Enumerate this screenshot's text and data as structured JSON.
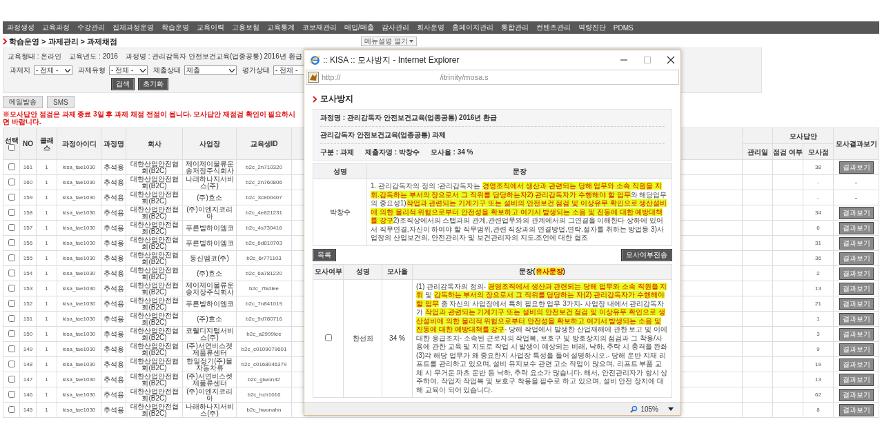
{
  "nav": [
    "과정생성",
    "교육과정",
    "수강관리",
    "집체과정운영",
    "학습운영",
    "교육이력",
    "고용보험",
    "교육통계",
    "코보재관리",
    "매입/매출",
    "감사관리",
    "회사운영",
    "홈페이지관리",
    "통합관리",
    "컨텐츠관리",
    "역량진단",
    "PDMS"
  ],
  "breadcrumb": "학습운영 > 과제관리 > 과제채점",
  "menu_help_button": "메뉴설명 열기",
  "filters": {
    "info": [
      "교육형태 : 온라인",
      "교육년도 : 2016",
      "과정명 : 관리감독자 안전보건교육(업종공통) 2016년 환급"
    ],
    "selects": [
      {
        "label": "과제지",
        "value": "- 전체 -"
      },
      {
        "label": "과제유형",
        "value": "- 전체 -"
      },
      {
        "label": "제출상태",
        "value": "제출"
      },
      {
        "label": "평가상태",
        "value": "- 전체 -"
      }
    ],
    "buttons": [
      "검색",
      "초기화"
    ]
  },
  "actions": [
    "메일발송",
    "SMS"
  ],
  "notice": "※모사답안 점검은 과제 종료 3일 후 과제 채점 전점이 됩니다. 모사답안 재점검 확인이 필요하시면 바랍니다.",
  "table": {
    "select_header": "선택",
    "select_all_checked": false,
    "columns_left": [
      "NO",
      "클래스",
      "과정아이디",
      "과정명",
      "회사",
      "사업장",
      "교육생ID"
    ],
    "columns_right": {
      "group": "모사답안",
      "date": "관리일",
      "check": "점검 여부",
      "score": "모사점",
      "result": "모사결과보기"
    },
    "rows": [
      {
        "checked": false,
        "no": "161",
        "class": "1",
        "course_id": "kisa_tae1030",
        "course_name": "추석용",
        "company": "대한산업안전협회(B2C)",
        "site": "제이제이물류운송저장주식회사",
        "student_id": "b2c_2n710320",
        "score": "38",
        "result": {
          "kind": "button",
          "label": "결과보기"
        }
      },
      {
        "checked": false,
        "no": "160",
        "class": "1",
        "course_id": "kisa_tae1030",
        "course_name": "추석용",
        "company": "대한산업안전협회(B2C)",
        "site": "나래하나지서비스(주)",
        "student_id": "b2c_2n760806",
        "score": "-",
        "result": {
          "kind": "text",
          "label": "-"
        }
      },
      {
        "checked": false,
        "no": "159",
        "class": "1",
        "course_id": "kisa_tae1030",
        "course_name": "추석용",
        "company": "대한산업안전협회(B2C)",
        "site": "(주)효소",
        "student_id": "b2c_3c800407",
        "score": "-",
        "result": {
          "kind": "text",
          "label": "-"
        }
      },
      {
        "checked": false,
        "no": "158",
        "class": "1",
        "course_id": "kisa_tae1030",
        "course_name": "추석용",
        "company": "대한산업안전협회(B2C)",
        "site": "(주)이엔지코리아",
        "student_id": "b2c_4e821231",
        "score": "34",
        "result": {
          "kind": "button",
          "label": "결과보기"
        }
      },
      {
        "checked": false,
        "no": "157",
        "class": "1",
        "course_id": "kisa_tae1030",
        "course_name": "추석용",
        "company": "대한산업안전협회(B2C)",
        "site": "푸른빌하이엠코",
        "student_id": "b2c_4s730416",
        "score": "6",
        "result": {
          "kind": "button",
          "label": "결과보기"
        }
      },
      {
        "checked": false,
        "no": "156",
        "class": "1",
        "course_id": "kisa_tae1030",
        "course_name": "추석용",
        "company": "대한산업안전협회(B2C)",
        "site": "푸른빌하이엠코",
        "student_id": "b2c_6d810703",
        "score": "31",
        "result": {
          "kind": "button",
          "label": "결과보기"
        }
      },
      {
        "checked": false,
        "no": "155",
        "class": "1",
        "course_id": "kisa_tae1030",
        "course_name": "추석용",
        "company": "대한산업안전협회(B2C)",
        "site": "동신엠코(주)",
        "student_id": "b2c_6r771103",
        "score": "36",
        "result": {
          "kind": "button",
          "label": "결과보기"
        }
      },
      {
        "checked": false,
        "no": "154",
        "class": "1",
        "course_id": "kisa_tae1030",
        "course_name": "추석용",
        "company": "대한산업안전협회(B2C)",
        "site": "(주)효소",
        "student_id": "b2c_6a781220",
        "score": "2",
        "result": {
          "kind": "button",
          "label": "결과보기"
        }
      },
      {
        "checked": false,
        "no": "153",
        "class": "1",
        "course_id": "kisa_tae1030",
        "course_name": "추석용",
        "company": "대한산업안전협회(B2C)",
        "site": "제이제이물류운송저장주식회사",
        "student_id": "b2c_7tkdlee",
        "score": "13",
        "result": {
          "kind": "button",
          "label": "결과보기"
        }
      },
      {
        "checked": false,
        "no": "152",
        "class": "1",
        "course_id": "kisa_tae1030",
        "course_name": "추석용",
        "company": "대한산업안전협회(B2C)",
        "site": "푸른빌하이엠코",
        "student_id": "b2c_7n841019",
        "score": "21",
        "result": {
          "kind": "button",
          "label": "결과보기"
        }
      },
      {
        "checked": false,
        "no": "151",
        "class": "1",
        "course_id": "kisa_tae1030",
        "course_name": "추석용",
        "company": "대한산업안전협회(B2C)",
        "site": "(주)효소",
        "student_id": "b2c_9d780716",
        "score": "1",
        "result": {
          "kind": "button",
          "label": "결과보기"
        }
      },
      {
        "checked": false,
        "no": "150",
        "class": "1",
        "course_id": "kisa_tae1030",
        "course_name": "추석용",
        "company": "대한산업안전협회(B2C)",
        "site": "코웰디지털서비스(주)",
        "student_id": "b2c_a2999lee",
        "score": "3",
        "result": {
          "kind": "button",
          "label": "결과보기"
        }
      },
      {
        "checked": false,
        "no": "149",
        "class": "1",
        "course_id": "kisa_tae1030",
        "course_name": "추석용",
        "company": "대한산업안전협회(B2C)",
        "site": "(주)서연비스켓제품류센터",
        "student_id": "b2c_c0109079601",
        "score": "9",
        "result": {
          "kind": "button",
          "label": "결과보기"
        }
      },
      {
        "checked": false,
        "no": "148",
        "class": "1",
        "course_id": "kisa_tae1030",
        "course_name": "추석용",
        "company": "대한산업안전협회(B2C)",
        "site": "한일정기(주)물자동차류",
        "student_id": "b2c_c0168046379",
        "score": "19",
        "result": {
          "kind": "button",
          "label": "결과보기"
        }
      },
      {
        "checked": false,
        "no": "147",
        "class": "1",
        "course_id": "kisa_tae1030",
        "course_name": "추석용",
        "company": "대한산업안전협회(B2C)",
        "site": "(주)서연비스켓제품류센터",
        "student_id": "b2c_giwon32",
        "score": "13",
        "result": {
          "kind": "button",
          "label": "결과보기"
        }
      },
      {
        "checked": false,
        "no": "146",
        "class": "1",
        "course_id": "kisa_tae1030",
        "course_name": "추석용",
        "company": "대한산업안전협회(B2C)",
        "site": "(주)이엔지코리아",
        "student_id": "b2c_hch1016",
        "score": "62",
        "result": {
          "kind": "button",
          "label": "결과보기"
        }
      },
      {
        "checked": false,
        "no": "145",
        "class": "1",
        "course_id": "kisa_tae1030",
        "course_name": "추석용",
        "company": "대한산업안전협회(B2C)",
        "site": "나래하나지서비스(주)",
        "student_id": "b2c_hwonahn",
        "score": "8",
        "result": {
          "kind": "button",
          "label": "결과보기"
        }
      }
    ]
  },
  "popup": {
    "title": ":: KISA :: 모사방지 - Internet Explorer",
    "url_start": "http://",
    "url_end": "/itrinity/mosa.s",
    "heading": "모사방지",
    "info": {
      "course": "과정명 : 관리감독자 안전보건교육(업종공통) 2016년 환급",
      "assignment": "관리감독자 안전보건교육(업종공통) 과제",
      "meta": [
        "구분 : 과제",
        "제출자명 : 박창수",
        "모사율 : 34 %"
      ]
    },
    "submission": {
      "columns": [
        "성명",
        "문장"
      ],
      "name": "박창수",
      "sentence": [
        {
          "text": "1. 관리감독자의 정의 :관리감독자는 ",
          "highlighted": false
        },
        {
          "text": "경영조직에서 생산과 관련되는 당해 업무와 소속 직원을 지휘.감독하는 부서의 장으로서 그 직위를 담당하는자2) 관리감독자가 수행해야 할 업무",
          "highlighted": true
        },
        {
          "text": "와 해당업무의 중요성1)",
          "highlighted": false
        },
        {
          "text": "작업과 관련되는 기계기구 또는 설비의 안전보건 점검 및 이상유무 확인으로 생산설비에 의한 물리적 위험으로부터 안전성을 확보하고 여기서 발생되는 소음 및 진동에 대한 예방대책를 강구",
          "highlighted": true
        },
        {
          "text": "2)조직상에서의 스탭과의 관계,관련업무와의 관계에서의 그연결을 이해한다 상하에 있어서 직무연결,자신이 하여야 할 직무범위,관련 직장과의 연결방법,연락.절차를 취하는 방법등 3)사업장의 산업보건의, 안전관리자 및 보건관리자의 지도.조언에 대한 협조",
          "highlighted": false
        }
      ]
    },
    "buttons": [
      "목록",
      "모사여부전송"
    ],
    "matches": {
      "columns": [
        "모사여부",
        "성명",
        "모사율"
      ],
      "header_sentence": [
        {
          "text": "문장(",
          "highlighted": false
        },
        {
          "text": "유사문장",
          "highlighted": true
        },
        {
          "text": ")",
          "highlighted": false
        }
      ],
      "rows": [
        {
          "checked": false,
          "name": "한선희",
          "rate": "34 %",
          "sentence": [
            {
              "text": "(1) 관리감독자의 정의- ",
              "highlighted": false
            },
            {
              "text": "경영조직에서 생산과 관련되는 당해 업무와 소속 직원을 지휘",
              "highlighted": true
            },
            {
              "text": " 및 ",
              "highlighted": false
            },
            {
              "text": "감독하는 부서의 장으로서 그 직위를 담당하는 자(2) 관리감독자가 수행해야 할 업무",
              "highlighted": true
            },
            {
              "text": " 중 자신의 사업장에서 특히 필요한 업무 3가지- 사업장 내에서 관리감독자가 ",
              "highlighted": false
            },
            {
              "text": "작업과 관련되는 기계기구 또는 설비의 안전보건 점검 및 이상유무 확인으로 생산설비에 의한 물리적 위험으로부터 안전성을 확보하고 여기서 발생되는 소음 및 진동에 대한 예방대책를 강구",
              "highlighted": true
            },
            {
              "text": "- 당해 작업에서 발생한 산업재해에 관한 보고 및 이에 대한 응급조치- 소속된 근로자의 작업복, 보호구 및 방호장치의 점검과 그 착용/사용에 관한 교육 및 지도로 작업 시 발생이 예상되는 비래, 낙하, 추락 시 충격을 완화(3)각 해당 업무가 왜 중요한지 사업장 특성을 들어 설명하시오.- 당해 운반 지재 리프트를 관리하고 있으며, 설비 유지보수 관련 고소 작업이 많으며, 리프트 부품 교체 시 무거운 파츠 운반 등 낙하, 추락 요소가 많습니다. 해서, 안전관리자가 항시 상주하여, 작업자 작업복 및 보호구 착용을 필수로 하고 있으며, 설비 안전 장치에 대해 교육이 되어 있습니다.",
              "highlighted": false
            }
          ]
        }
      ]
    },
    "zoom": "105%"
  }
}
